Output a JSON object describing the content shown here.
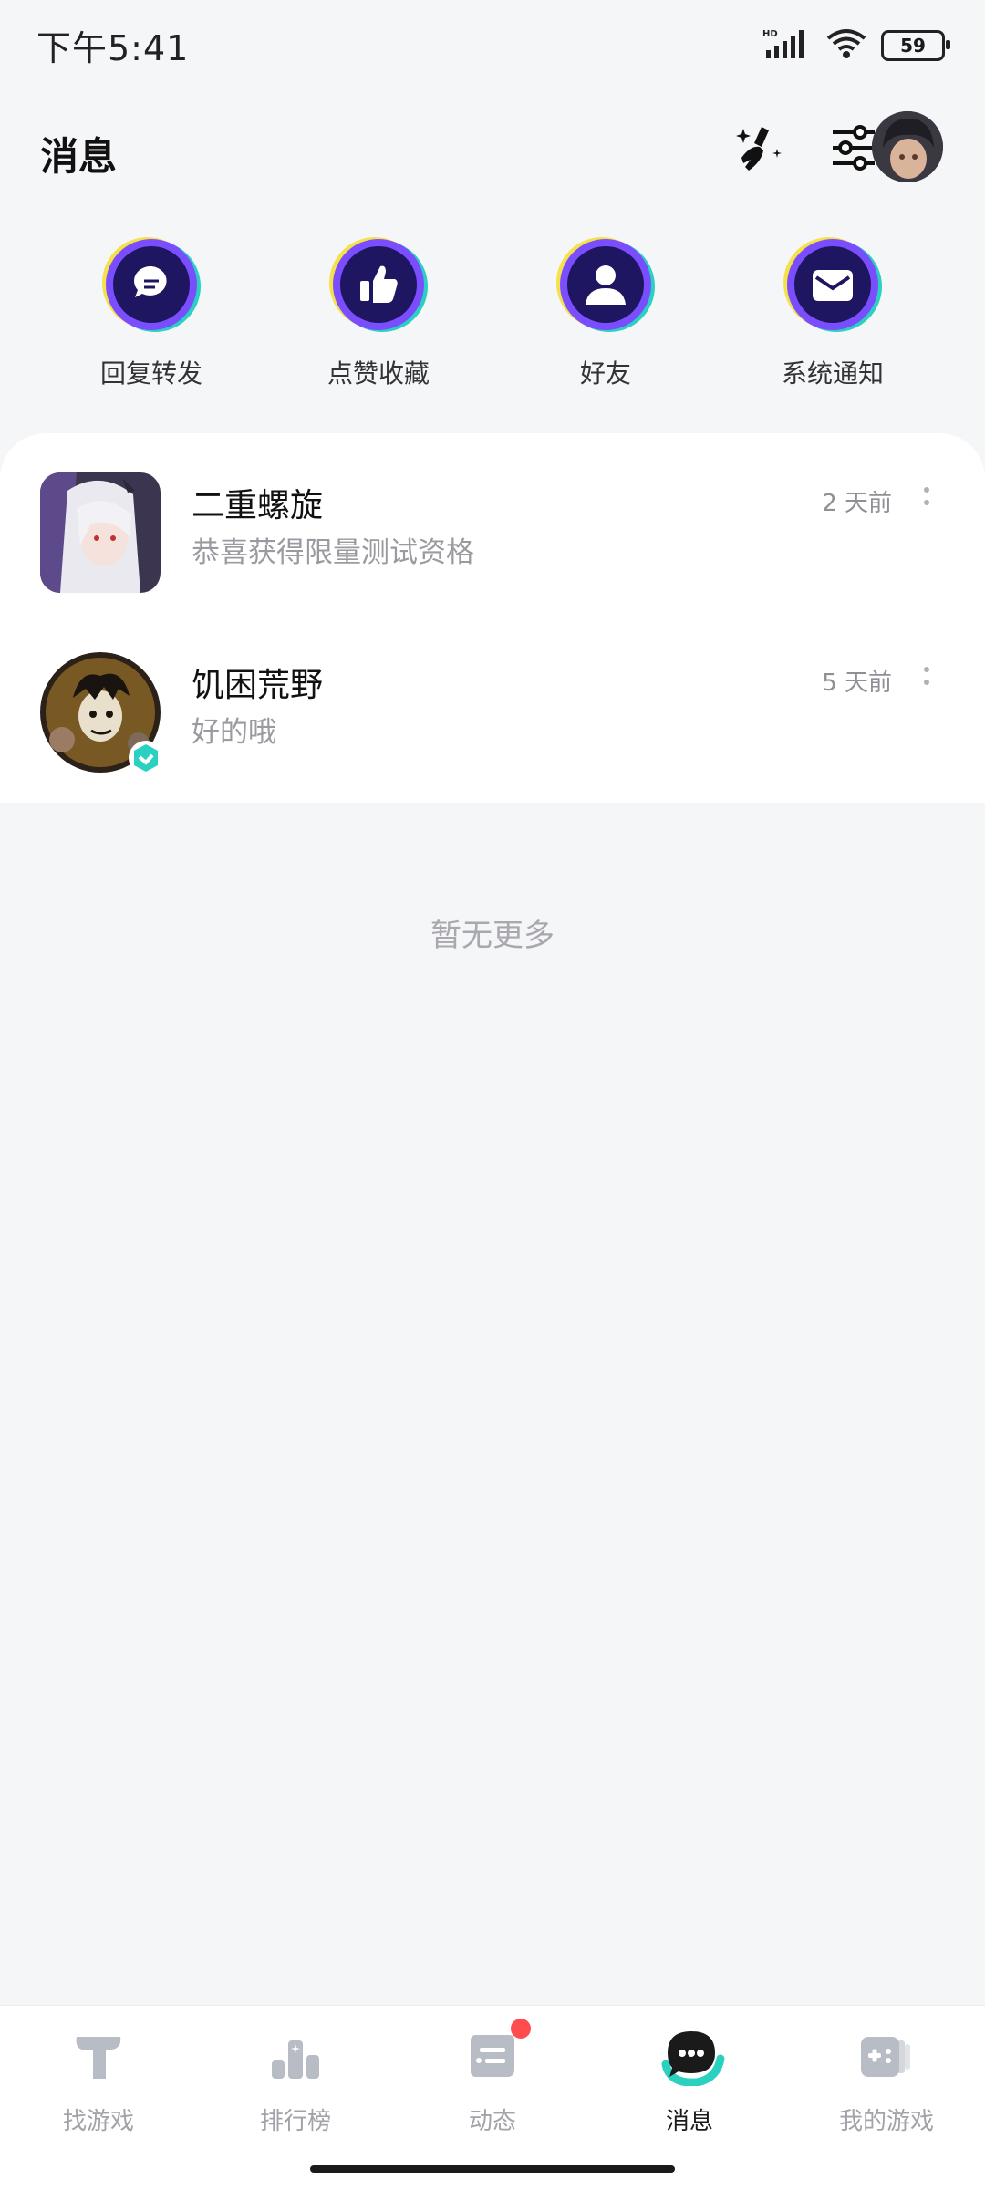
{
  "status_bar": {
    "time": "下午5:41",
    "battery": "59",
    "network": "HD"
  },
  "header": {
    "title": "消息"
  },
  "categories": [
    {
      "label": "回复转发",
      "icon": "comment-icon"
    },
    {
      "label": "点赞收藏",
      "icon": "thumbs-up-icon"
    },
    {
      "label": "好友",
      "icon": "user-icon"
    },
    {
      "label": "系统通知",
      "icon": "envelope-icon"
    }
  ],
  "messages": [
    {
      "name": "二重螺旋",
      "message": "恭喜获得限量测试资格",
      "time": "2 天前"
    },
    {
      "name": "饥困荒野",
      "message": "好的哦",
      "time": "5 天前"
    }
  ],
  "empty_text": "暂无更多",
  "nav": [
    {
      "label": "找游戏",
      "active": false
    },
    {
      "label": "排行榜",
      "active": false
    },
    {
      "label": "动态",
      "active": false,
      "badge": true
    },
    {
      "label": "消息",
      "active": true
    },
    {
      "label": "我的游戏",
      "active": false
    }
  ],
  "colors": {
    "accent": "#2ad1c0",
    "category_circle": "#1e1660",
    "category_ring": "#7a4dff",
    "badge": "#ff4d4f"
  }
}
